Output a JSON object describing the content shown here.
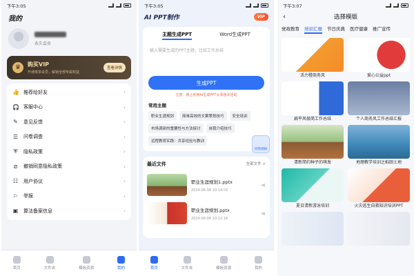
{
  "colors": {
    "accent": "#2e6bf3",
    "vip_gold": "#f4d9a3",
    "warning": "#f06a4a"
  },
  "screen1": {
    "status": {
      "time": "下午3:05",
      "icons": "signal wifi battery"
    },
    "title": "我的",
    "profile": {
      "validity": "永久会员"
    },
    "vip": {
      "title": "购买VIP",
      "subtitle": "开通尊享会员，解锁全部专属权益",
      "button": "查看详情"
    },
    "menu": [
      {
        "icon": "thumbs-up-icon",
        "glyph": "👍",
        "label": "推荐给好友"
      },
      {
        "icon": "headset-icon",
        "glyph": "🎧",
        "label": "客服中心"
      },
      {
        "icon": "feedback-icon",
        "glyph": "✎",
        "label": "意见反馈"
      },
      {
        "icon": "survey-icon",
        "glyph": "☰",
        "label": "问卷调查"
      },
      {
        "icon": "shield-icon",
        "glyph": "⛨",
        "label": "隐私政策"
      },
      {
        "icon": "revoke-icon",
        "glyph": "⊘",
        "label": "撤销同意隐私政策"
      },
      {
        "icon": "user-agreement-icon",
        "glyph": "☷",
        "label": "用户协议"
      },
      {
        "icon": "report-icon",
        "glyph": "⚐",
        "label": "举报"
      },
      {
        "icon": "filing-icon",
        "glyph": "▣",
        "label": "算法备案信息"
      }
    ],
    "tabs": [
      {
        "icon": "home-icon",
        "label": "首页"
      },
      {
        "icon": "folder-icon",
        "label": "文件夹"
      },
      {
        "icon": "template-icon",
        "label": "模板资源"
      },
      {
        "icon": "profile-icon",
        "label": "我的"
      }
    ],
    "active_tab": 3
  },
  "screen2": {
    "status": {
      "time": "下午3:05"
    },
    "title": "AI PPT制作",
    "vip_badge": "VIP",
    "mode_tabs": [
      "主题生成PPT",
      "Word生成PPT"
    ],
    "active_mode": 0,
    "input_placeholder": "输入需要生成的PPT主题，比如工作总结",
    "generate_button": "生成PPT",
    "warning": "注意：禁止利用AI生成PPT从事违法活动",
    "themes_title": "常用主题",
    "themes": [
      "职业生涯规划",
      "简单高效的文案策划技巧",
      "安全培训",
      "市场调研的重要性与方法探讨",
      "自我介绍技巧",
      "远程教育实践：共享经验与教训"
    ],
    "float_badge": "问卷调研",
    "recent": {
      "title": "最近文件",
      "view_all": "全部文件 >",
      "files": [
        {
          "name": "职业生涯规划1.pptx",
          "time": "2024-06-08 10:14:03"
        },
        {
          "name": "职业生涯规划.pptx",
          "time": "2024-06-08 10:12:18"
        }
      ]
    },
    "tabs": [
      {
        "icon": "home-icon",
        "label": "首页"
      },
      {
        "icon": "folder-icon",
        "label": "文件夹"
      },
      {
        "icon": "template-icon",
        "label": "模板资源"
      },
      {
        "icon": "profile-icon",
        "label": "我的"
      }
    ],
    "active_tab": 0
  },
  "screen3": {
    "status": {
      "time": "下午3:07"
    },
    "title": "选择模版",
    "categories": [
      "党政教育",
      "培训汇报",
      "节日庆典",
      "医疗健康",
      "推广宣传"
    ],
    "active_category": 1,
    "templates": [
      {
        "label": "活力橙商务风"
      },
      {
        "label": "爱心公益ppt"
      },
      {
        "label": "扁平风极简工作总结"
      },
      {
        "label": "个人商务风工作总结汇报"
      },
      {
        "label": "清新简约种子的萌发"
      },
      {
        "label": "地理教学培训之稻田土地"
      },
      {
        "label": "夏日清新游泳培训"
      },
      {
        "label": "火灾逃生自救知识培训PPT"
      },
      {
        "label": ""
      },
      {
        "label": ""
      }
    ]
  }
}
